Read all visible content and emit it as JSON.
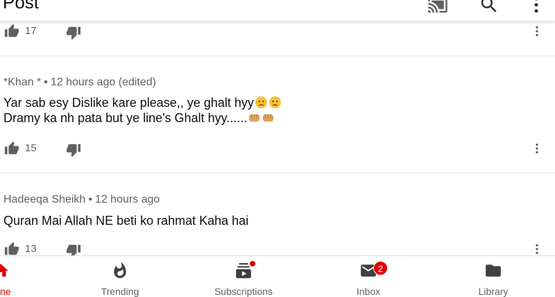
{
  "header": {
    "title": "Post"
  },
  "comments": [
    {
      "likes": "17"
    },
    {
      "author": "*Khan *",
      "time": "12 hours ago (edited)",
      "line1": "Yar sab esy Dislike kare please,, ye ghalt hyy",
      "line2": "Dramy ka nh pata but ye line's Ghalt hyy......",
      "likes": "15"
    },
    {
      "author": "Hadeeqa Sheikh",
      "time": "12 hours ago",
      "line1": "Quran Mai Allah NE beti ko rahmat Kaha hai",
      "likes": "13"
    }
  ],
  "separator": "•",
  "nav": {
    "home": "ne",
    "trending": "Trending",
    "subscriptions": "Subscriptions",
    "inbox": "Inbox",
    "inbox_badge": "2",
    "library": "Library"
  },
  "colors": {
    "accent": "#e00000",
    "secondary_text": "#606060",
    "primary_text": "#0f0f0f"
  }
}
